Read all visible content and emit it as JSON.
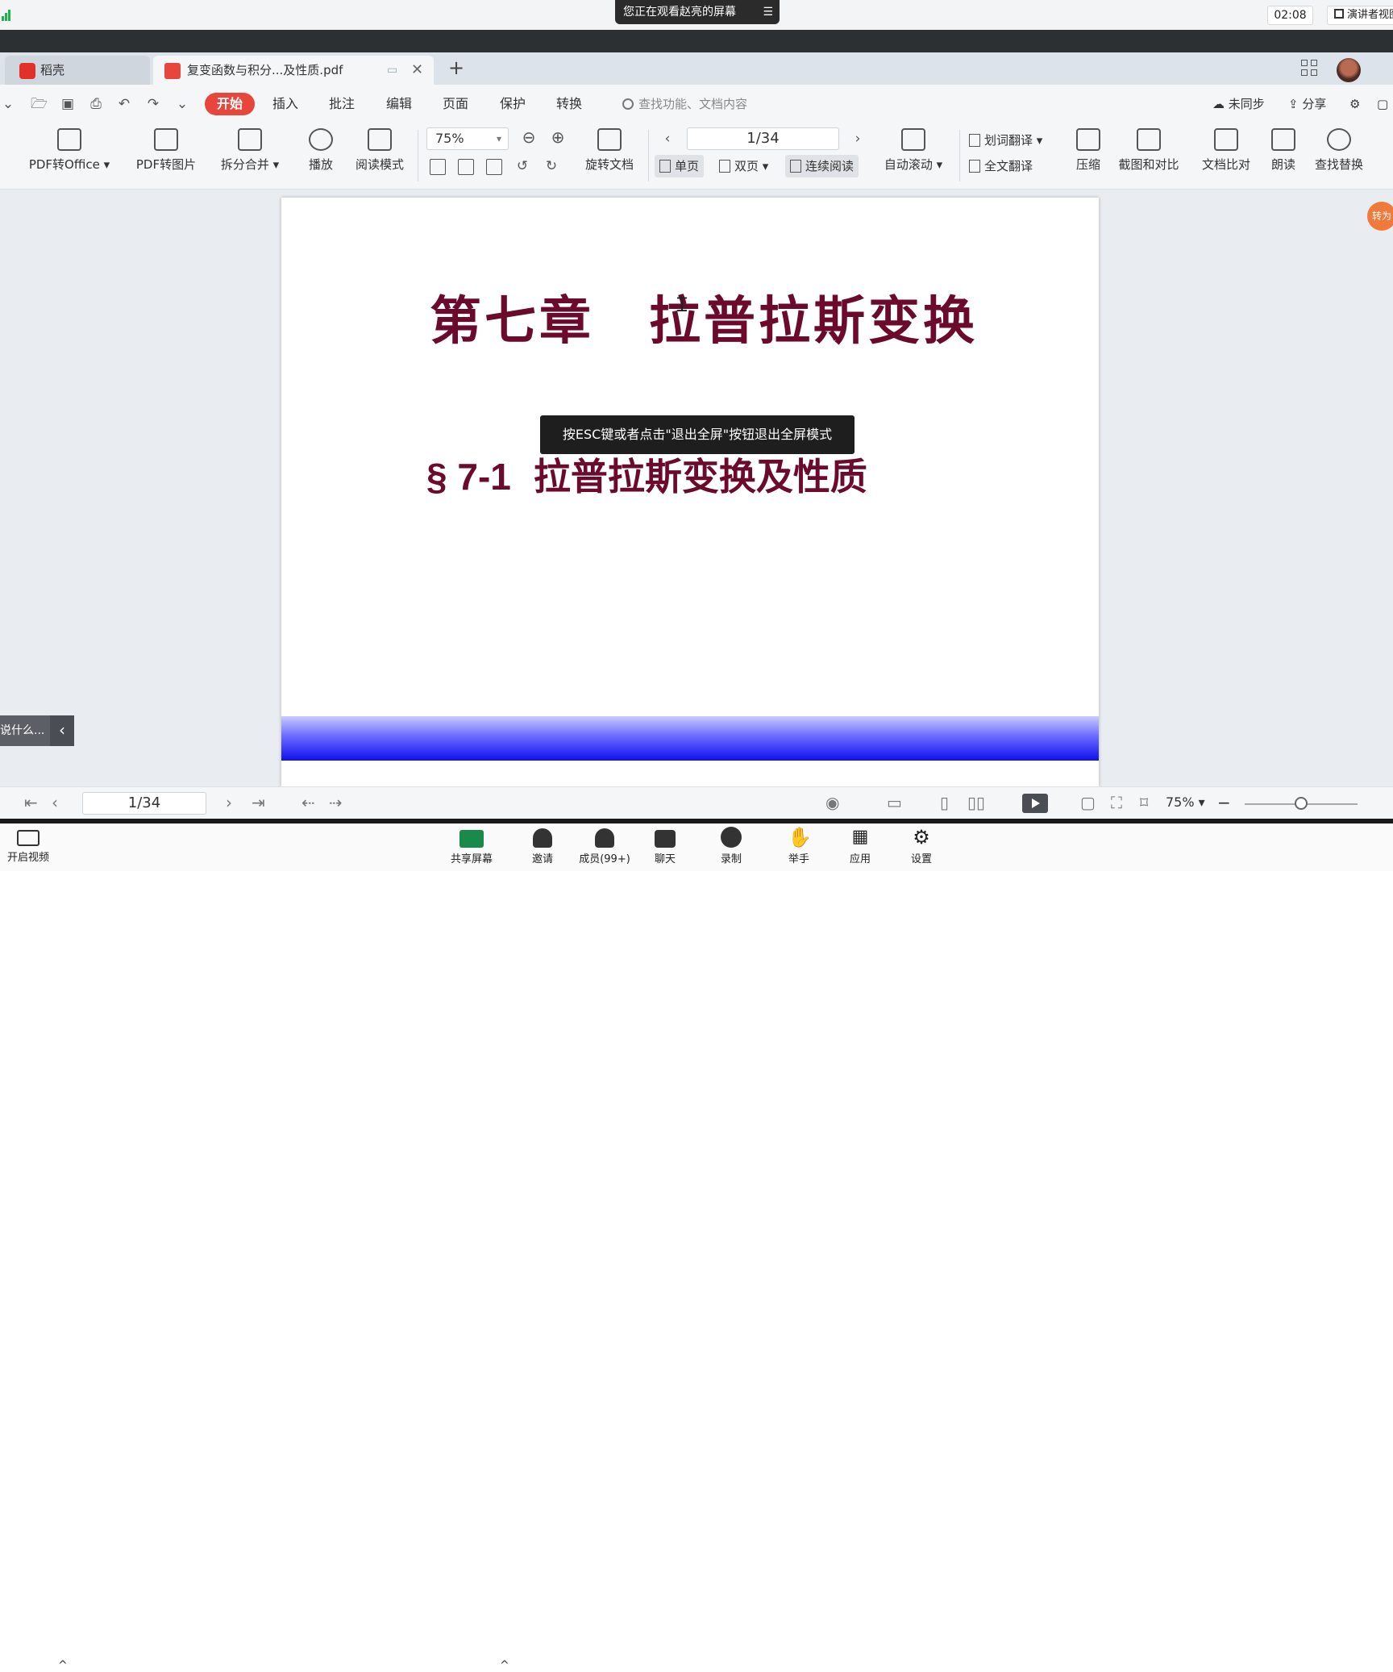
{
  "meeting": {
    "viewing_banner": "您正在观看赵亮的屏幕",
    "clock": "02:08",
    "presenter_view": "演讲者视图"
  },
  "tabs": {
    "home_label": "稻壳",
    "doc_label": "复变函数与积分...及性质.pdf"
  },
  "menu": {
    "items": [
      "开始",
      "插入",
      "批注",
      "编辑",
      "页面",
      "保护",
      "转换"
    ],
    "search_placeholder": "查找功能、文档内容",
    "sync_label": "未同步",
    "share_label": "分享"
  },
  "ribbon": {
    "pdf_to_office": "PDF转Office",
    "pdf_to_image": "PDF转图片",
    "split_merge": "拆分合并",
    "play": "播放",
    "read_mode": "阅读模式",
    "zoom": "75%",
    "rotate_doc": "旋转文档",
    "page_indicator": "1/34",
    "single_page": "单页",
    "double_page": "双页",
    "continuous": "连续阅读",
    "auto_scroll": "自动滚动",
    "word_translate": "划词翻译",
    "full_translate": "全文翻译",
    "compress": "压缩",
    "screenshot_compare": "截图和对比",
    "doc_compare": "文档比对",
    "read_aloud": "朗读",
    "find_replace": "查找替换"
  },
  "document": {
    "chapter_title": "第七章　拉普拉斯变换",
    "section_number": "§ 7-1",
    "section_title": "拉普拉斯变换及性质"
  },
  "overlays": {
    "esc_tip": "按ESC键或者点击\"退出全屏\"按钮退出全屏模式",
    "side_chat": "说什么...",
    "convert_badge": "转为"
  },
  "statusbar": {
    "page": "1/34",
    "zoom": "75%"
  },
  "meeting_bar": {
    "video": "开启视频",
    "share_screen": "共享屏幕",
    "invite": "邀请",
    "members": "成员(99+)",
    "chat": "聊天",
    "record": "录制",
    "raise_hand": "举手",
    "apps": "应用",
    "settings": "设置"
  },
  "colors": {
    "accent": "#e8463c",
    "title_color": "#6b0a2a",
    "band_color": "#1010ee"
  }
}
